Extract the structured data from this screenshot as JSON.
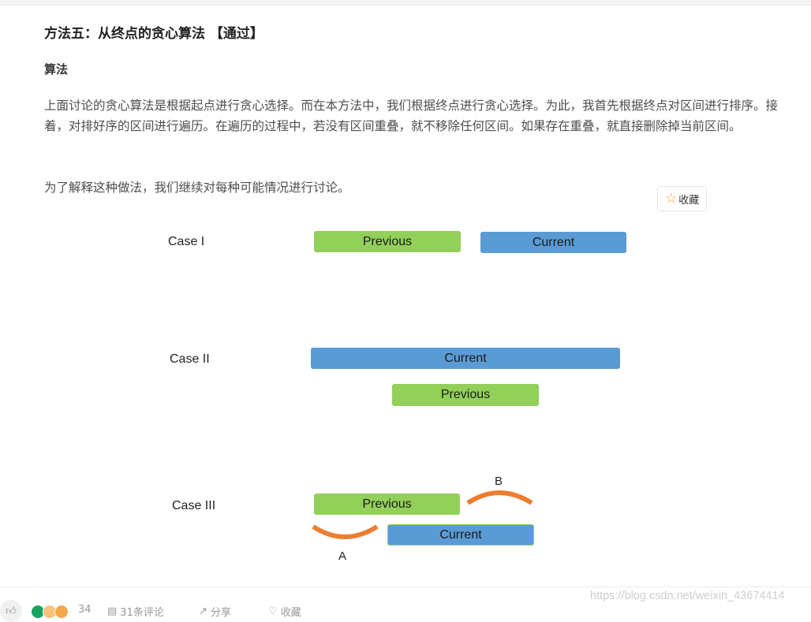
{
  "article": {
    "heading": "方法五：从终点的贪心算法 【通过】",
    "subheading": "算法",
    "paragraphs": [
      "上面讨论的贪心算法是根据起点进行贪心选择。而在本方法中，我们根据终点进行贪心选择。为此，我首先根据终点对区间进行排序。接着，对排好序的区间进行遍历。在遍历的过程中，若没有区间重叠，就不移除任何区间。如果存在重叠，就直接删除掉当前区间。",
      "为了解释这种做法，我们继续对每种可能情况进行讨论。"
    ]
  },
  "favorite_button": {
    "icon": "star-outline-icon",
    "label": "收藏"
  },
  "diagram": {
    "colors": {
      "previous": "#92d05a",
      "current": "#5b9bd5",
      "arc": "#ed7d31"
    },
    "cases": [
      {
        "label": "Case I",
        "intervals": [
          {
            "name": "Previous",
            "color": "green"
          },
          {
            "name": "Current",
            "color": "blue"
          }
        ]
      },
      {
        "label": "Case II",
        "intervals": [
          {
            "name": "Current",
            "color": "blue"
          },
          {
            "name": "Previous",
            "color": "green"
          }
        ]
      },
      {
        "label": "Case III",
        "intervals": [
          {
            "name": "Previous",
            "color": "green"
          },
          {
            "name": "Current",
            "color": "blue"
          }
        ],
        "arcs": [
          {
            "label": "A"
          },
          {
            "label": "B"
          }
        ]
      }
    ]
  },
  "footer": {
    "like_icon": "thumbs-up-icon",
    "reaction_count": "34",
    "comments": "31条评论",
    "share": "分享",
    "favorite": "收藏"
  },
  "watermark": "https://blog.csdn.net/weixin_43674414"
}
